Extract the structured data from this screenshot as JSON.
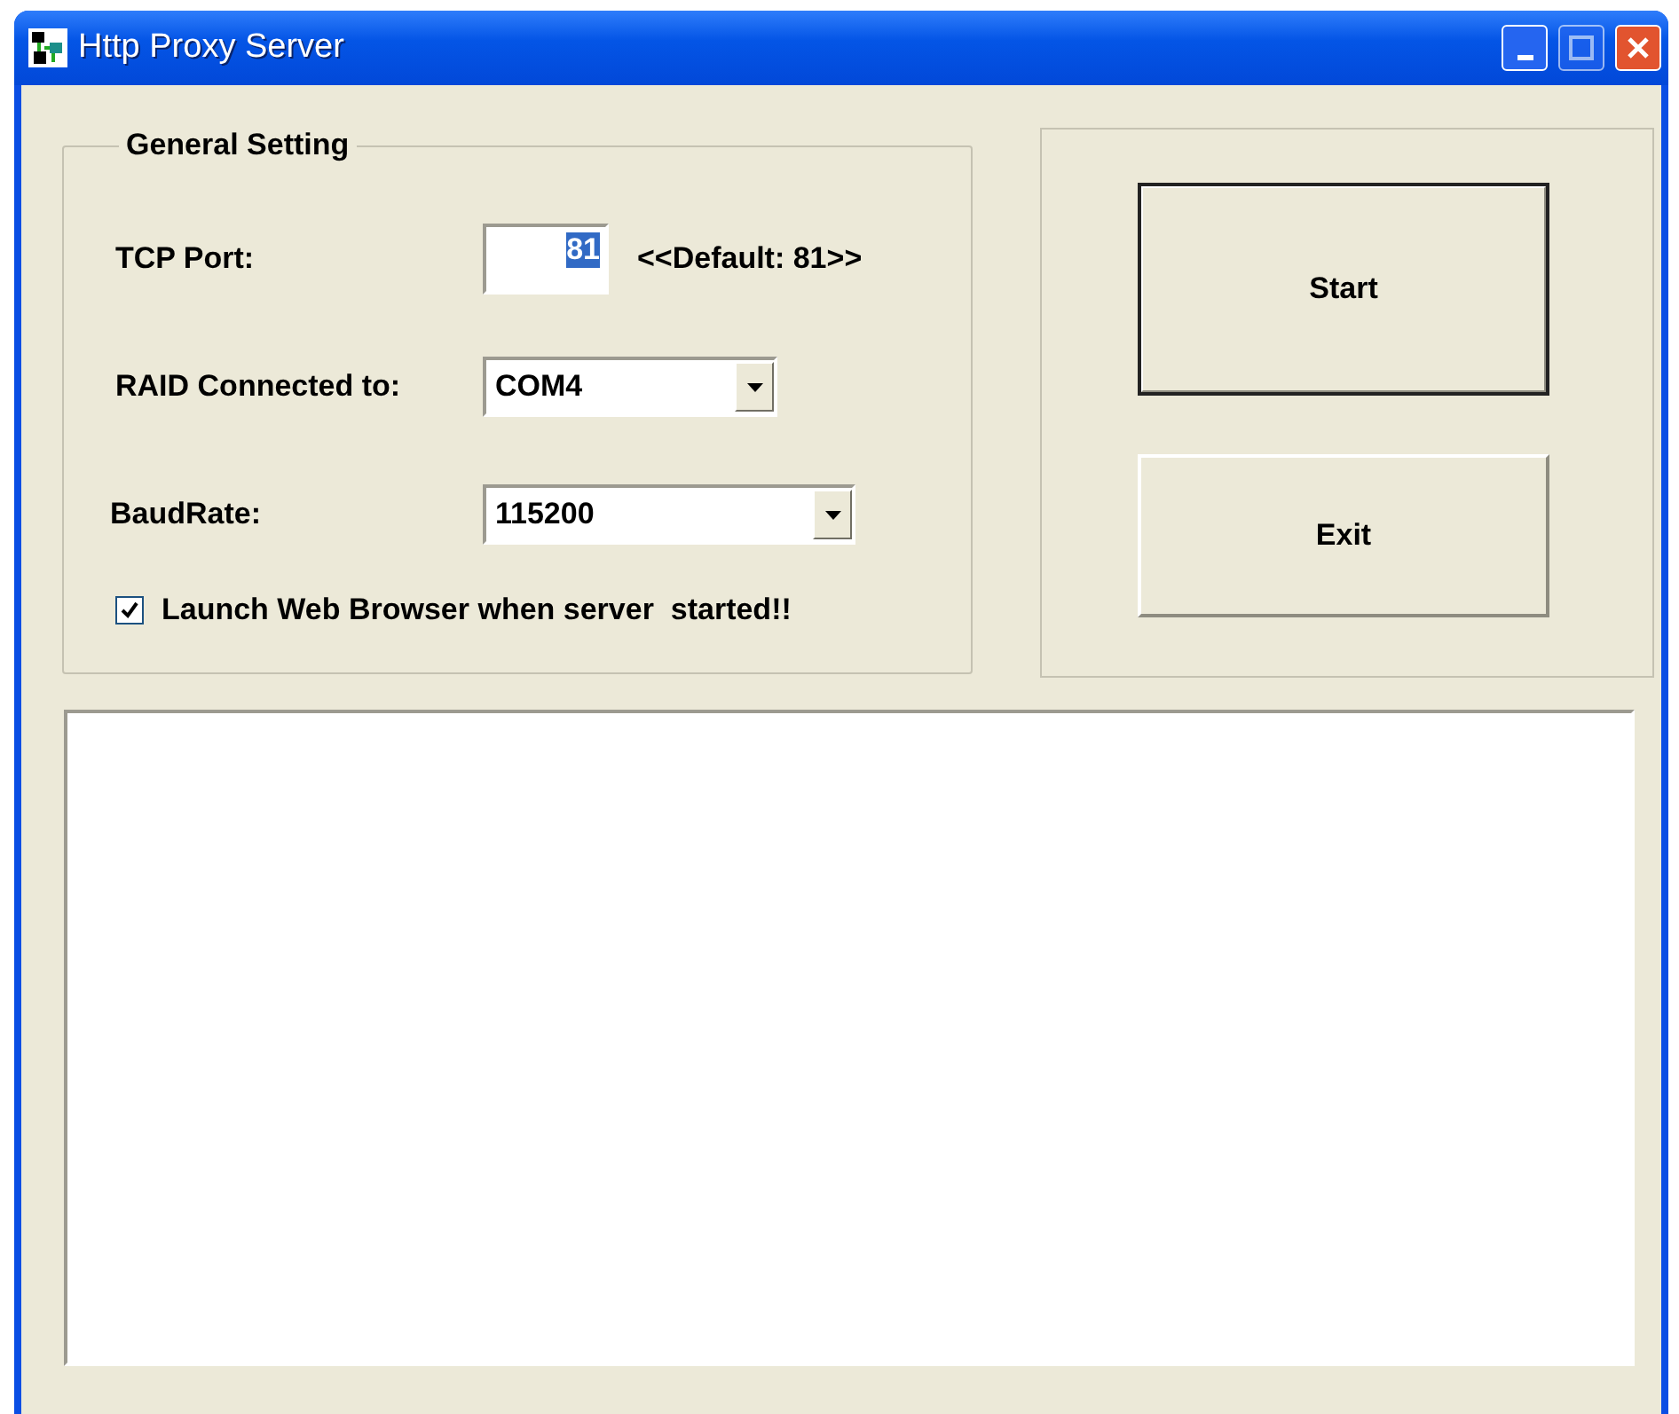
{
  "window": {
    "title": "Http Proxy Server"
  },
  "general_setting": {
    "title": "General Setting",
    "tcp_port": {
      "label": "TCP Port:",
      "value": "81",
      "selected": true,
      "hint": "<<Default: 81>>"
    },
    "raid_connected_to": {
      "label": "RAID Connected to:",
      "value": "COM4"
    },
    "baud_rate": {
      "label": "BaudRate:",
      "value": "115200"
    },
    "launch_browser": {
      "label": "Launch Web Browser when server  started!!",
      "checked": true
    }
  },
  "buttons": [
    {
      "label": "Start",
      "default": true
    },
    {
      "label": "Exit",
      "default": false
    }
  ]
}
